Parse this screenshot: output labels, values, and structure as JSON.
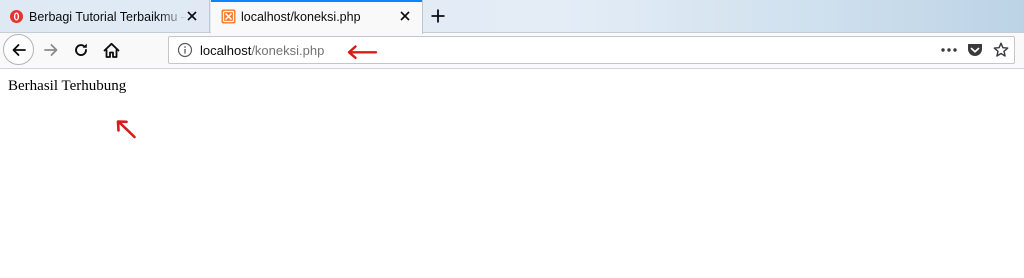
{
  "tabs": [
    {
      "title": "Berbagi Tutorial Terbaikmu – In",
      "favicon": "opera-red-circle-icon"
    },
    {
      "title": "localhost/koneksi.php",
      "favicon": "xampp-orange-icon",
      "active": true
    }
  ],
  "address_bar": {
    "host": "localhost",
    "path": "/koneksi.php"
  },
  "toolbar_icons": [
    "back-arrow-icon",
    "forward-arrow-icon",
    "reload-icon",
    "home-icon",
    "info-icon",
    "more-dots-icon",
    "pocket-icon",
    "star-icon"
  ],
  "page": {
    "body_text": "Berhasil Terhubung"
  },
  "annotation_color": "#d81b1b",
  "accent_color": "#0a84ff"
}
